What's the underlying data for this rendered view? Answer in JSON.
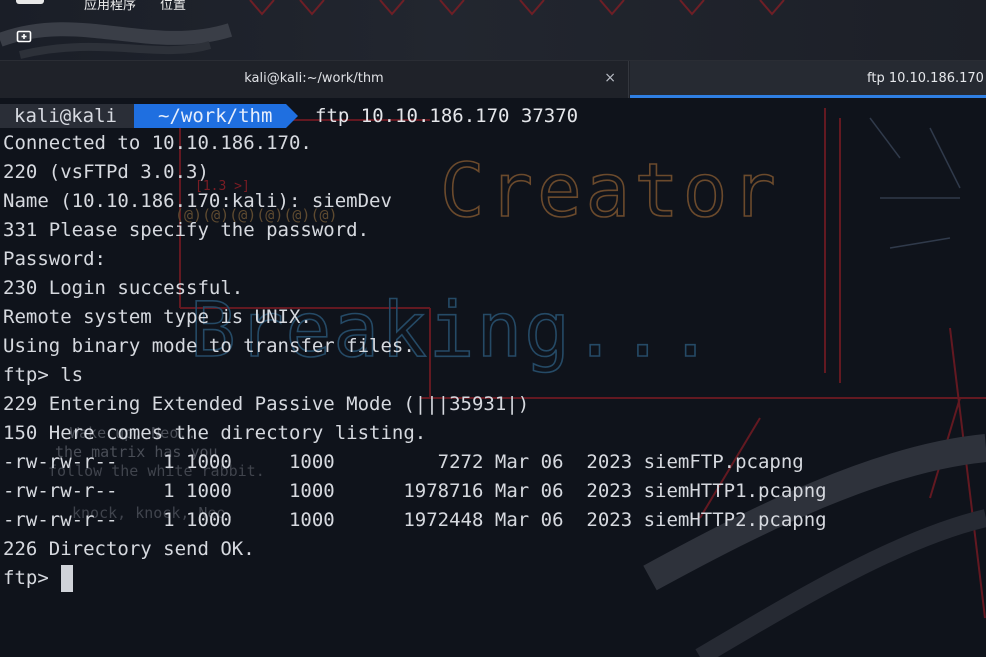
{
  "panel": {
    "menu_apps": "应用程序",
    "menu_places": "位置"
  },
  "tabs": [
    {
      "title": "kali@kali:~/work/thm",
      "close": "×"
    },
    {
      "title": "ftp 10.10.186.170 37370"
    }
  ],
  "prompt": {
    "user_host": "kali@kali",
    "path": "~/work/thm",
    "command": "ftp 10.10.186.170 37370"
  },
  "output_lines": [
    "Connected to 10.10.186.170.",
    "220 (vsFTPd 3.0.3)",
    "Name (10.10.186.170:kali): siemDev",
    "331 Please specify the password.",
    "Password:",
    "230 Login successful.",
    "Remote system type is UNIX.",
    "Using binary mode to transfer files.",
    "ftp> ls",
    "229 Entering Extended Passive Mode (|||35931|)",
    "150 Here comes the directory listing.",
    "-rw-rw-r--    1 1000     1000         7272 Mar 06  2023 siemFTP.pcapng",
    "-rw-rw-r--    1 1000     1000      1978716 Mar 06  2023 siemHTTP1.pcapng",
    "-rw-rw-r--    1 1000     1000      1972448 Mar 06  2023 siemHTTP2.pcapng",
    "226 Directory send OK."
  ],
  "input_prompt": "ftp> ",
  "wallpaper_text": {
    "word_creator": "Creator",
    "word_breaking": "Breaking...",
    "matrix_1": "Wake up, Neo...",
    "matrix_2": "the matrix has you",
    "matrix_3": "follow the white rabbit.",
    "matrix_4": "knock, knock, Neo.",
    "at_row": "(@)(@)(@)(@)(@)(@)",
    "bracket_tag": "[1.3 >]"
  },
  "colors": {
    "accent_blue": "#1f6fe0",
    "tab_indicator": "#2f7fe3",
    "terminal_bg": "#0f131b",
    "wallpaper_red": "#7a1c24",
    "wallpaper_orange": "#6b4a2c",
    "wallpaper_blue": "#254a66"
  },
  "icons": {
    "new_tab": "new-tab-icon",
    "close": "close-icon"
  }
}
